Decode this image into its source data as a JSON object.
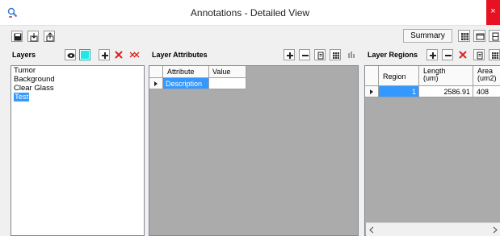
{
  "window": {
    "title": "Annotations - Detailed View",
    "close_glyph": "×"
  },
  "toolbar": {
    "summary_label": "Summary"
  },
  "layers": {
    "label": "Layers",
    "color_swatch": "#1ee8e8",
    "items": [
      "Tumor",
      "Background",
      "Clear Glass",
      "Test"
    ],
    "selected_index": 3
  },
  "layer_attributes": {
    "label": "Layer Attributes",
    "columns": [
      "Attribute",
      "Value"
    ],
    "rows": [
      {
        "attribute": "Description",
        "value": ""
      }
    ]
  },
  "layer_regions": {
    "label": "Layer Regions",
    "columns": [
      "Region",
      "Length\n(um)",
      "Area\n(um2)"
    ],
    "rows": [
      {
        "region": "1",
        "length": "2586.91",
        "area": "408"
      }
    ]
  },
  "colors": {
    "accent_selection": "#3399ff",
    "close_red": "#e81123",
    "delete_red": "#e0201c",
    "grid_bg": "#ababab"
  },
  "icons": [
    "app-icon",
    "save-icon",
    "import-icon",
    "export-icon",
    "eye-icon",
    "add-icon",
    "delete-icon",
    "delete-all-icon",
    "remove-icon",
    "properties-icon",
    "table-icon",
    "bar-chart-icon",
    "grid-view-icon",
    "single-view-icon",
    "split-view-icon",
    "scroll-left-icon",
    "scroll-right-icon"
  ]
}
